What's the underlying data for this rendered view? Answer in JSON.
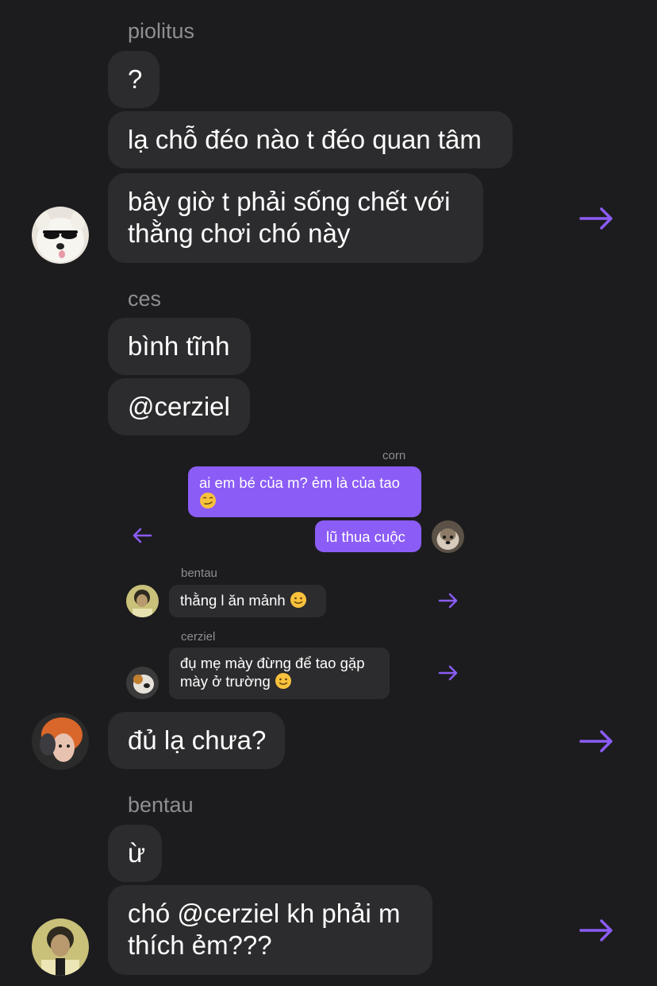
{
  "colors": {
    "background": "#1c1c1e",
    "bubble": "#2c2c2e",
    "accent": "#8b5cf6",
    "sender": "#8e8e93"
  },
  "groups": [
    {
      "sender": "piolitus",
      "messages": [
        "?",
        "lạ chỗ đéo nào t đéo quan tâm",
        "bây giờ t phải sống chết với",
        "thằng chơi chó này"
      ],
      "avatar_icon": "samoyed-sunglasses-avatar",
      "action_icon": "forward-arrow-icon"
    },
    {
      "sender": "ces",
      "messages": [
        "bình tĩnh",
        "@cerziel"
      ]
    }
  ],
  "quoted": {
    "corn": {
      "sender": "corn",
      "messages": [
        "ai em bé của m? ẻm là của tao",
        "lũ thua cuộc"
      ],
      "emoji_icon": "smirking-face-emoji",
      "action_icon": "back-arrow-icon"
    },
    "bentau": {
      "sender": "bentau",
      "message": "thằng l ăn mảnh",
      "emoji_icon": "slightly-smiling-face-emoji",
      "action_icon": "forward-arrow-icon"
    },
    "cerziel": {
      "sender": "cerziel",
      "messages": [
        "đụ mẹ mày đừng để tao gặp",
        "mày ở trường"
      ],
      "emoji_icon": "slightly-smiling-face-emoji",
      "action_icon": "forward-arrow-icon"
    }
  },
  "ces_tail": {
    "message": "đủ lạ chưa?",
    "avatar_icon": "orange-hair-avatar",
    "action_icon": "forward-arrow-icon"
  },
  "bentau_group": {
    "sender": "bentau",
    "messages": [
      "ừ",
      "chó @cerziel kh phải m",
      "thích ẻm???"
    ],
    "avatar_icon": "yellow-photo-avatar",
    "action_icon": "forward-arrow-icon"
  }
}
